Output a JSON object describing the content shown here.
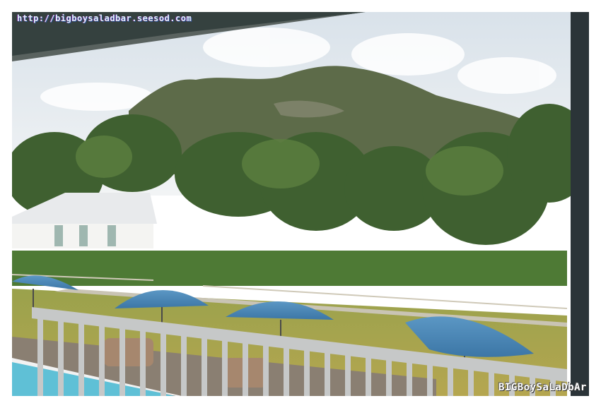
{
  "watermark": {
    "top_url": "http://bigboysaladbar.seesod.com",
    "bottom_signature": "BIGBoySaLaDbAr"
  },
  "scene": {
    "colors": {
      "sky": "#e9eef3",
      "mountain": "#5c6b48",
      "foliage": "#4a6a32",
      "lawn": "#a8a24a",
      "umbrella": "#4b86b4",
      "railing": "#c6c8c8",
      "pool": "#5fc0d6",
      "frame": "#2b3438"
    }
  }
}
